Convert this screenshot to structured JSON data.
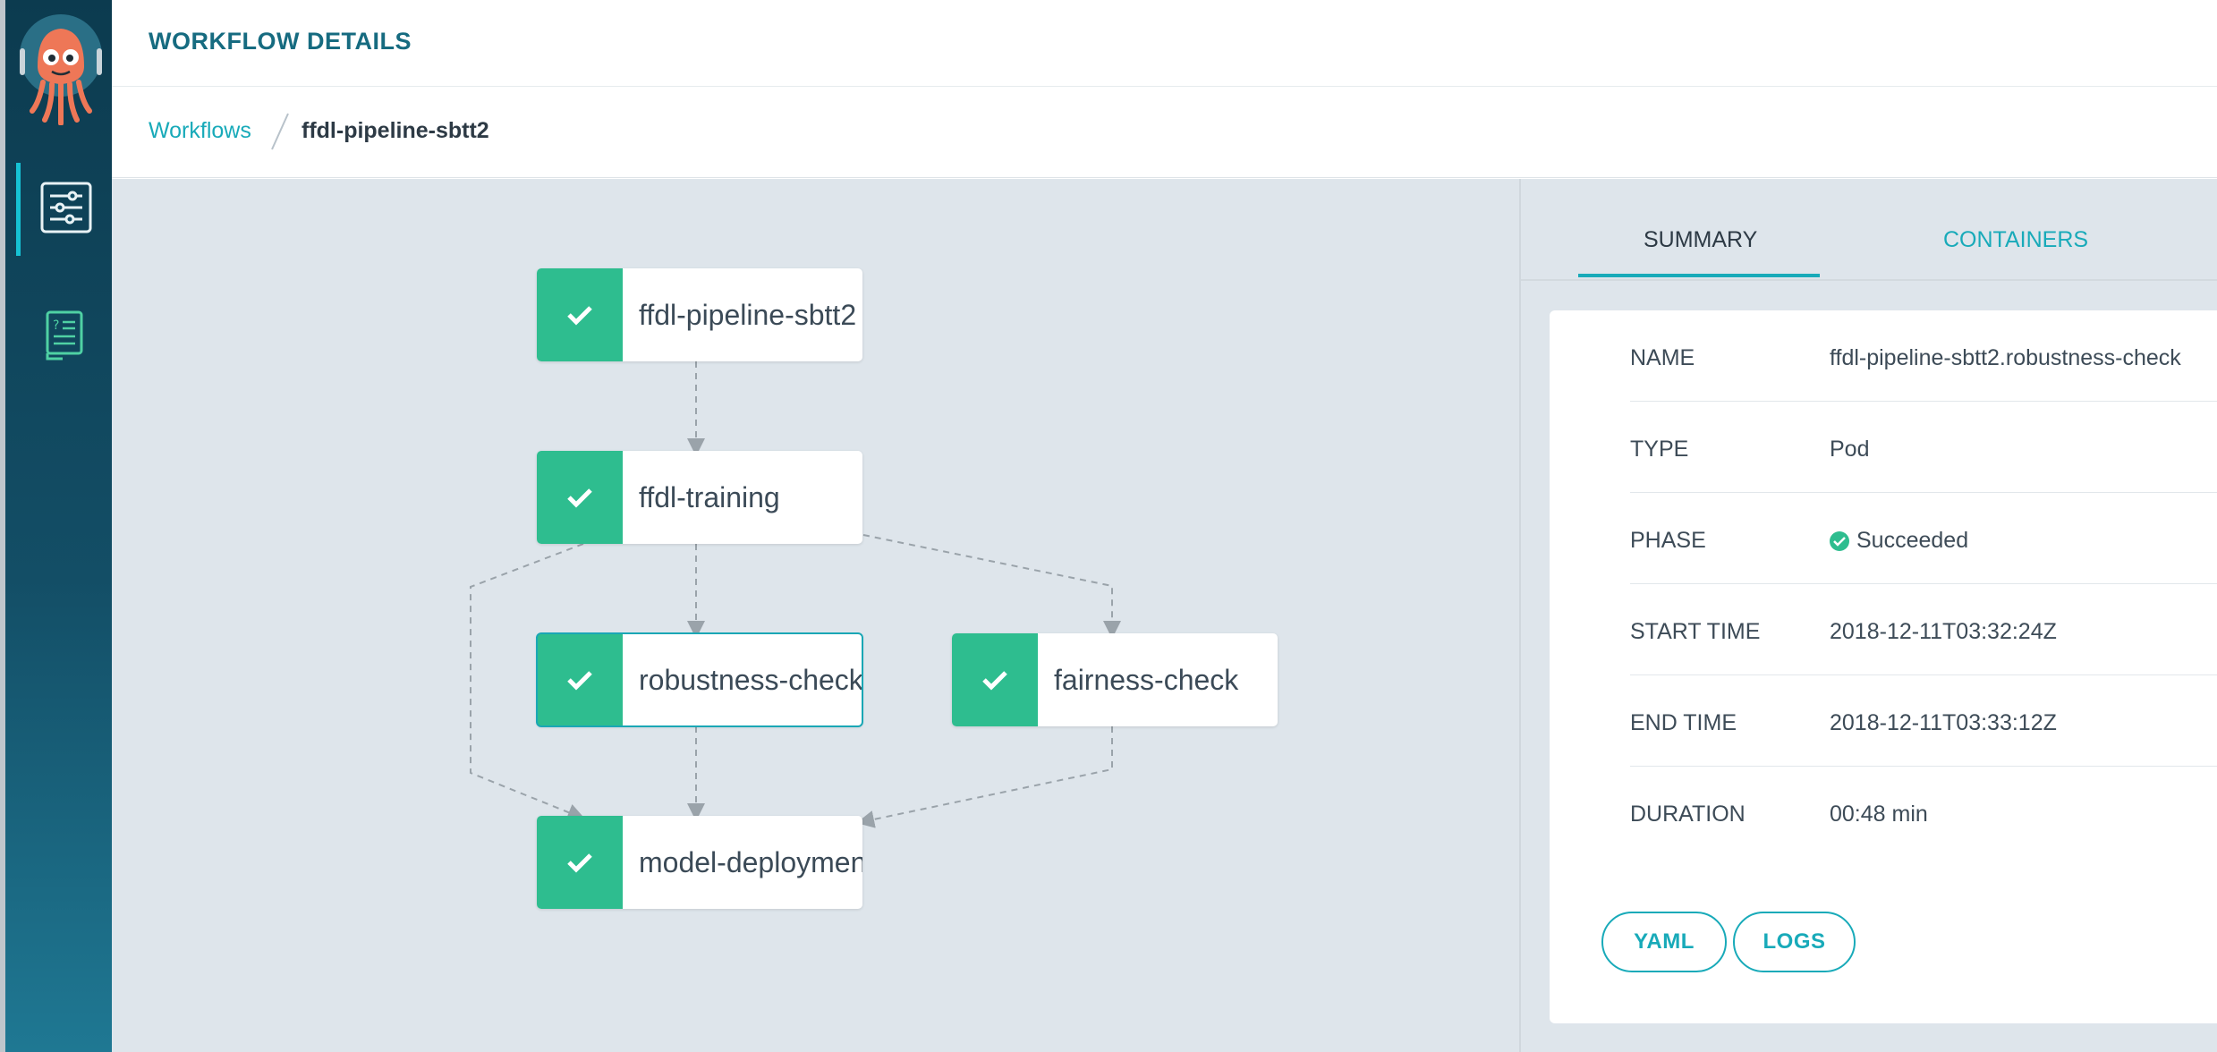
{
  "header": {
    "title": "WORKFLOW DETAILS"
  },
  "nav": {
    "items": [
      {
        "name": "workflows",
        "icon": "sliders-icon",
        "active": true
      },
      {
        "name": "help",
        "icon": "help-book-icon",
        "active": false
      }
    ]
  },
  "breadcrumb": {
    "parent": "Workflows",
    "current": "ffdl-pipeline-sbtt2"
  },
  "graph": {
    "nodes": [
      {
        "id": "root",
        "label": "ffdl-pipeline-sbtt2",
        "status": "succeeded"
      },
      {
        "id": "training",
        "label": "ffdl-training",
        "status": "succeeded"
      },
      {
        "id": "robustness",
        "label": "robustness-check",
        "status": "succeeded",
        "selected": true
      },
      {
        "id": "fairness",
        "label": "fairness-check",
        "status": "succeeded"
      },
      {
        "id": "deploy",
        "label": "model-deployment",
        "status": "succeeded"
      }
    ],
    "edges": [
      [
        "root",
        "training"
      ],
      [
        "training",
        "robustness"
      ],
      [
        "training",
        "fairness"
      ],
      [
        "training",
        "deploy"
      ],
      [
        "robustness",
        "deploy"
      ],
      [
        "fairness",
        "deploy"
      ]
    ]
  },
  "panel": {
    "tabs": [
      {
        "label": "SUMMARY",
        "active": true
      },
      {
        "label": "CONTAINERS",
        "active": false
      }
    ],
    "summary": [
      {
        "key": "NAME",
        "value": "ffdl-pipeline-sbtt2.robustness-check"
      },
      {
        "key": "TYPE",
        "value": "Pod"
      },
      {
        "key": "PHASE",
        "value": "Succeeded"
      },
      {
        "key": "START TIME",
        "value": "2018-12-11T03:32:24Z"
      },
      {
        "key": "END TIME",
        "value": "2018-12-11T03:33:12Z"
      },
      {
        "key": "DURATION",
        "value": "00:48 min"
      }
    ],
    "buttons": {
      "yaml": "YAML",
      "logs": "LOGS"
    }
  },
  "colors": {
    "accent": "#18aab9",
    "success": "#2ebd8f",
    "title": "#166b80",
    "canvas": "#dee5eb",
    "sidebar_top": "#0c3b4f",
    "sidebar_bottom": "#1f7893"
  }
}
